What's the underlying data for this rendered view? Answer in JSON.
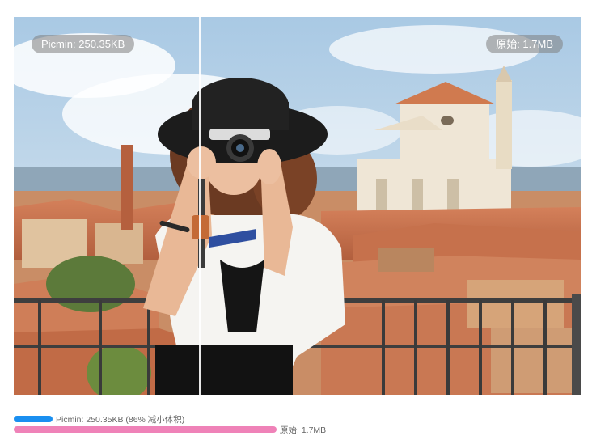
{
  "comparison": {
    "left_label": "Picmin: 250.35KB",
    "right_label": "原始: 1.7MB"
  },
  "stats": {
    "compressed_text": "Picmin: 250.35KB (86% 减小体积)",
    "original_text": "原始: 1.7MB",
    "compressed_ratio": 0.147,
    "original_ratio": 1.0,
    "compressed_color": "#1a8ff0",
    "original_color": "#ef82b8"
  }
}
